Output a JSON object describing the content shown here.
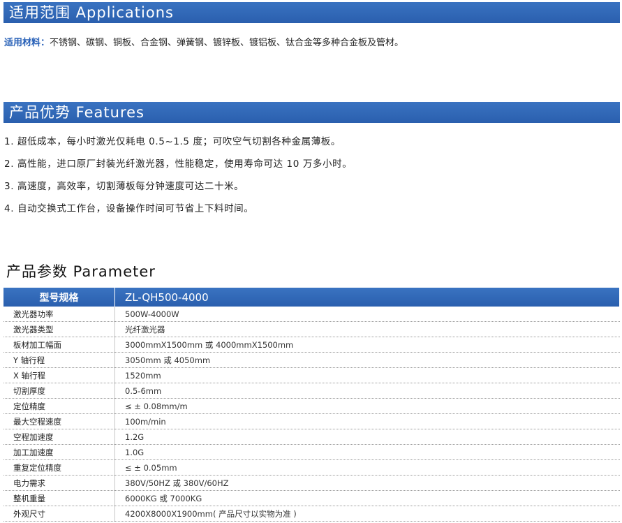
{
  "applications": {
    "heading": "适用范围 Applications",
    "materials_label": "适用材料：",
    "materials_text": "不锈钢、碳钢、铜板、合金钢、弹簧钢、镀锌板、镀铝板、钛合金等多种合金板及管材。"
  },
  "features": {
    "heading": "产品优势 Features",
    "items": [
      "1. 超低成本，每小时激光仅耗电 0.5~1.5 度；可吹空气切割各种金属薄板。",
      "2. 高性能，进口原厂封装光纤激光器，性能稳定，使用寿命可达 10 万多小时。",
      "3. 高速度，高效率，切割薄板每分钟速度可达二十米。",
      "4. 自动交换式工作台，设备操作时间可节省上下料时间。"
    ]
  },
  "parameter": {
    "heading": "产品参数 Parameter",
    "header_label": "型号规格",
    "header_value": "ZL-QH500-4000",
    "rows": [
      {
        "label": "激光器功率",
        "value": "500W-4000W"
      },
      {
        "label": "激光器类型",
        "value": "光纤激光器"
      },
      {
        "label": "板材加工幅面",
        "value": "3000mmX1500mm 或 4000mmX1500mm"
      },
      {
        "label": "Y 轴行程",
        "value": "3050mm 或 4050mm"
      },
      {
        "label": "X 轴行程",
        "value": "1520mm"
      },
      {
        "label": "切割厚度",
        "value": "0.5-6mm"
      },
      {
        "label": "定位精度",
        "value": "≤ ± 0.08mm/m"
      },
      {
        "label": "最大空程速度",
        "value": "100m/min"
      },
      {
        "label": "空程加速度",
        "value": "1.2G"
      },
      {
        "label": "加工加速度",
        "value": "1.0G"
      },
      {
        "label": "重复定位精度",
        "value": "≤ ± 0.05mm"
      },
      {
        "label": "电力需求",
        "value": "380V/50HZ 或 380V/60HZ"
      },
      {
        "label": "整机重量",
        "value": "6000KG 或 7000KG"
      },
      {
        "label": "外观尺寸",
        "value": "4200X8000X1900mm( 产品尺寸以实物为准 )"
      }
    ]
  },
  "colors": {
    "header_blue": "#2a5fae",
    "label_blue": "#2a62b8"
  }
}
